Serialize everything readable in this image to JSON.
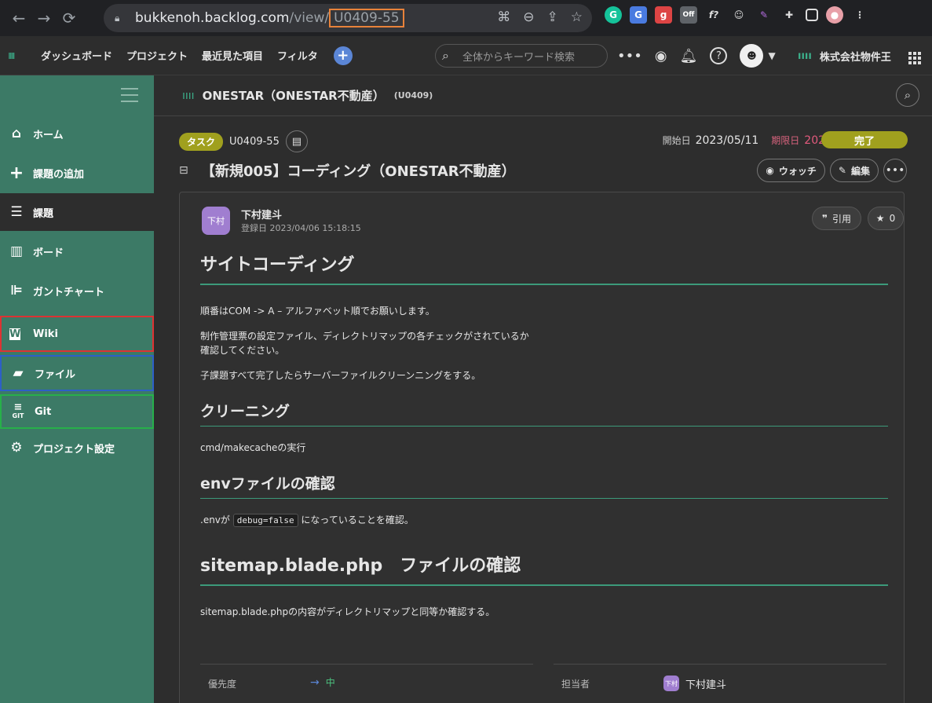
{
  "browser": {
    "url_host": "bukkenoh.backlog.com",
    "url_path": "/view/",
    "url_key": "U0409-55"
  },
  "header": {
    "nav": [
      "ダッシュボード",
      "プロジェクト",
      "最近見た項目",
      "フィルタ"
    ],
    "search_placeholder": "全体からキーワード検索",
    "company": "株式会社物件王"
  },
  "sidebar": {
    "items": [
      {
        "label": "ホーム",
        "icon": "home-icon"
      },
      {
        "label": "課題の追加",
        "icon": "plus-icon"
      },
      {
        "label": "課題",
        "icon": "list-icon"
      },
      {
        "label": "ボード",
        "icon": "board-icon"
      },
      {
        "label": "ガントチャート",
        "icon": "gantt-icon"
      },
      {
        "label": "Wiki",
        "icon": "wiki-icon"
      },
      {
        "label": "ファイル",
        "icon": "folder-icon"
      },
      {
        "label": "Git",
        "icon": "git-icon",
        "icon_caption": "GIT"
      },
      {
        "label": "プロジェクト設定",
        "icon": "gear-icon"
      }
    ]
  },
  "project": {
    "name": "ONESTAR（ONESTAR不動産）",
    "key": "(U0409)"
  },
  "issue": {
    "type_tag": "タスク",
    "key": "U0409-55",
    "start_label": "開始日",
    "start_date": "2023/05/11",
    "due_label": "期限日",
    "due_date": "2023/05/26",
    "status": "完了",
    "title": "【新規005】コーディング（ONESTAR不動産）",
    "watch_label": "ウォッチ",
    "edit_label": "編集"
  },
  "post": {
    "author": "下村建斗",
    "avatar_text": "下村",
    "date": "登録日 2023/04/06 15:18:15",
    "quote_label": "引用",
    "star_count": "0"
  },
  "body": {
    "h1": "サイトコーディング",
    "p1": "順番はCOM -> A – アルファベット順でお願いします。",
    "p2a": "制作管理票の設定ファイル、ディレクトリマップの各チェックがされているか",
    "p2b": "確認してください。",
    "p3": "子課題すべて完了したらサーバーファイルクリーンニングをする。",
    "h2a": "クリーニング",
    "p4": "cmd/makecacheの実行",
    "h2b": "envファイルの確認",
    "p5a": ".envが",
    "p5code": "debug=false",
    "p5b": "になっていることを確認。",
    "h1b": "sitemap.blade.php　ファイルの確認",
    "p6": "sitemap.blade.phpの内容がディレクトリマップと同等か確認する。"
  },
  "props": {
    "priority_label": "優先度",
    "priority_value": "中",
    "assignee_label": "担当者",
    "assignee_value": "下村建斗",
    "assignee_avatar": "下村"
  },
  "colors": {
    "sidebar": "#3c7a66",
    "accent": "#3c9a7a",
    "status": "#a0a01e",
    "due": "#e45a7d"
  }
}
